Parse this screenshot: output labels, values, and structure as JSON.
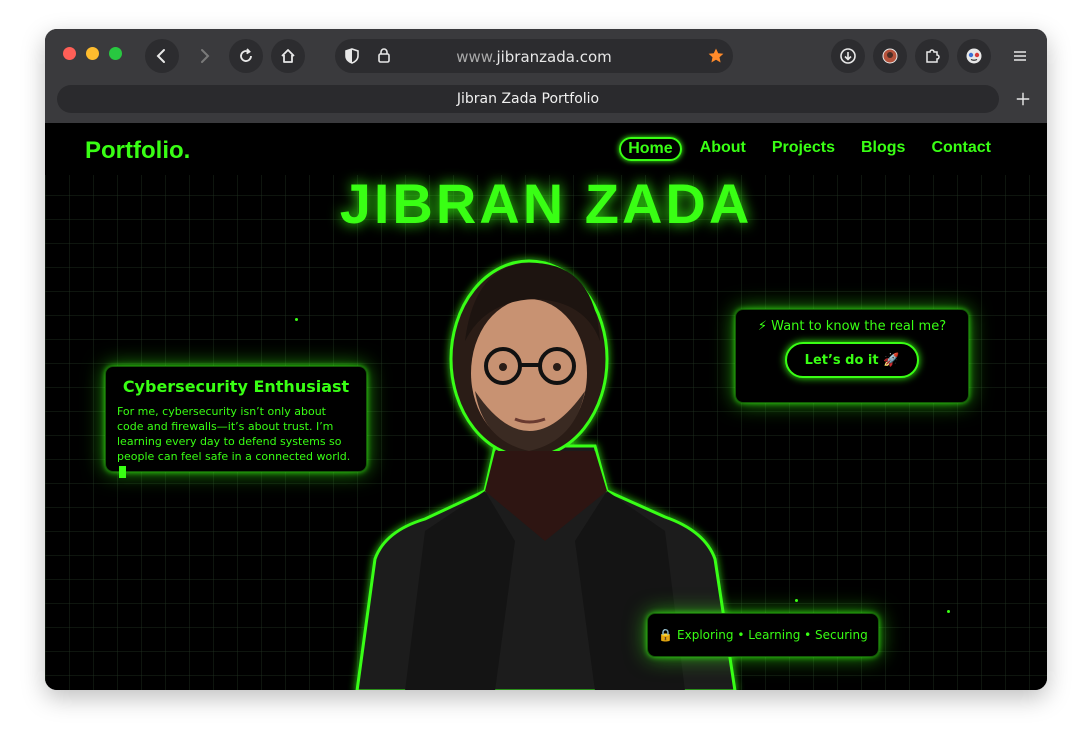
{
  "browser": {
    "url_prefix": "www.",
    "url_domain": "jibranzada.com",
    "tab_title": "Jibran Zada Portfolio",
    "colors": {
      "close": "#ff5f57",
      "minimize": "#febc2e",
      "maximize": "#28c840",
      "bookmark_star": "#ff8a2a"
    }
  },
  "site": {
    "logo": "Portfolio.",
    "nav": [
      {
        "label": "Home",
        "active": true
      },
      {
        "label": "About",
        "active": false
      },
      {
        "label": "Projects",
        "active": false
      },
      {
        "label": "Blogs",
        "active": false
      },
      {
        "label": "Contact",
        "active": false
      }
    ],
    "hero_name": "JIBRAN ZADA",
    "accent_color": "#39ff14",
    "intro_card": {
      "title": "Cybersecurity Enthusiast",
      "text": "For me, cybersecurity isn’t only about code and firewalls—it’s about trust. I’m learning every day to defend systems so people can feel safe in a connected world."
    },
    "cta_card": {
      "prompt": "⚡ Want to know the real me?",
      "button": "Let’s do it 🚀"
    },
    "tagline": "🔒 Exploring • Learning • Securing"
  }
}
